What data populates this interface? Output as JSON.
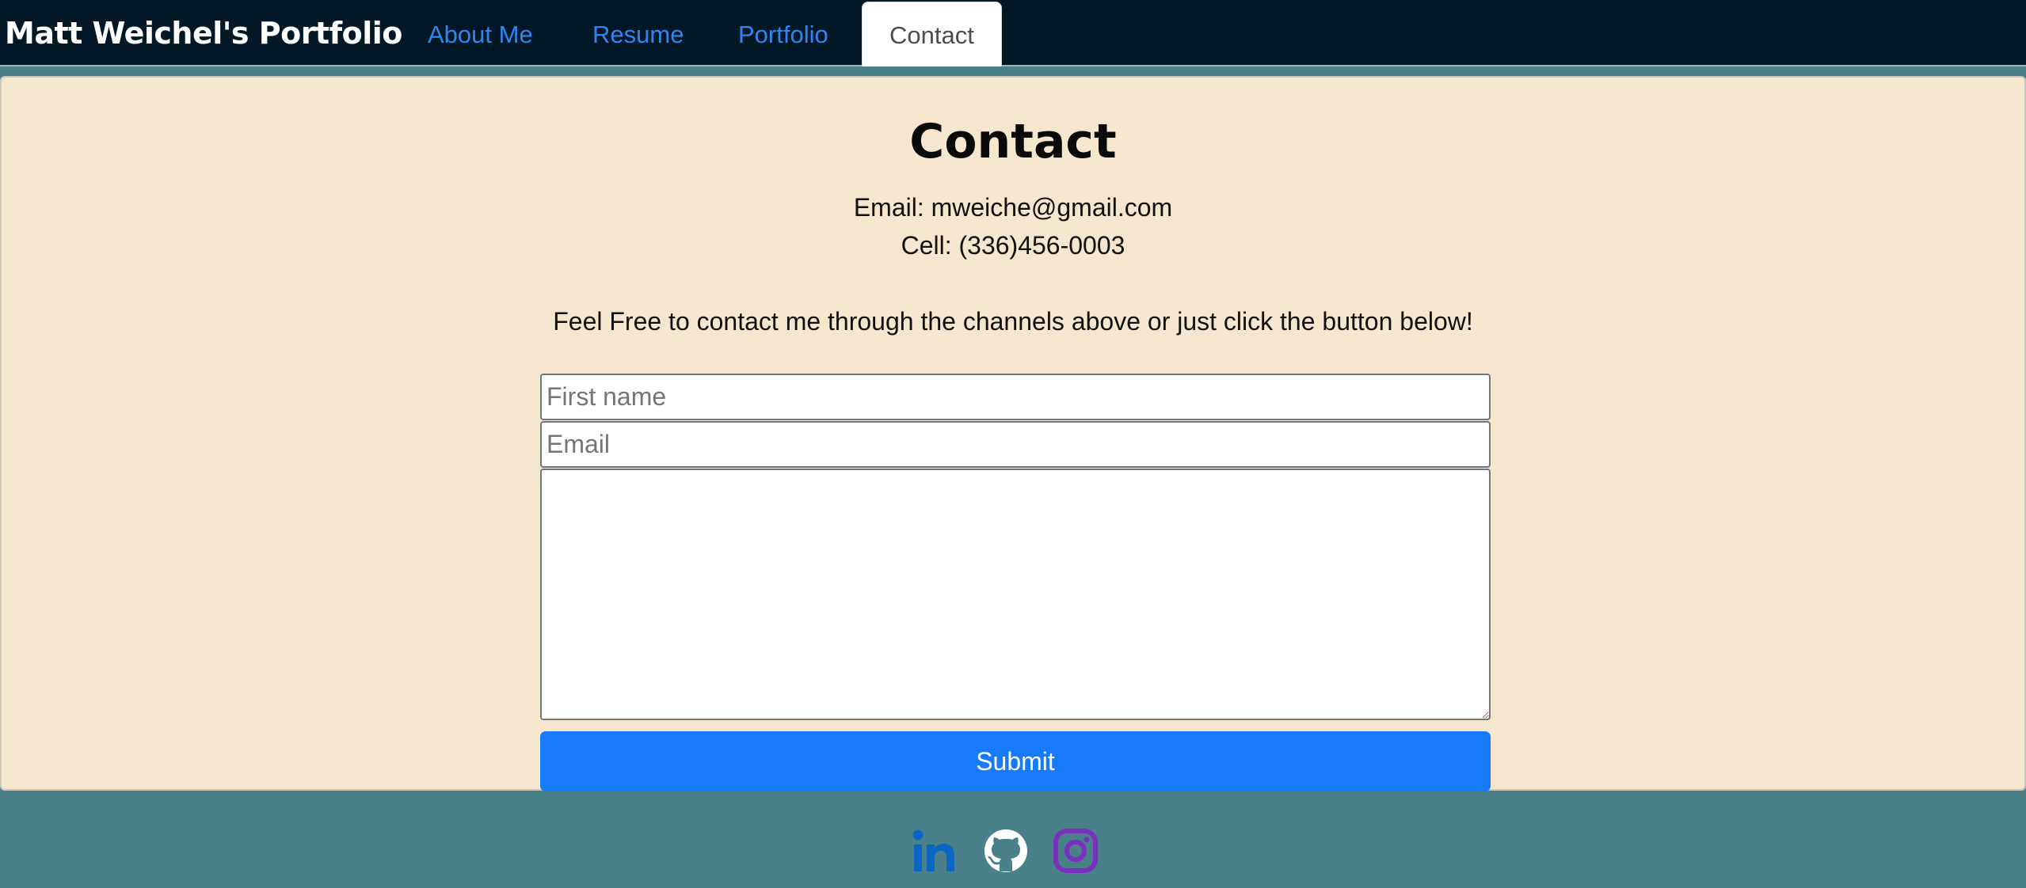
{
  "nav": {
    "brand": "Matt Weichel's Portfolio",
    "links": [
      {
        "label": "About Me"
      },
      {
        "label": "Resume"
      },
      {
        "label": "Portfolio"
      },
      {
        "label": "Contact",
        "active": true
      }
    ]
  },
  "contact": {
    "title": "Contact",
    "email_line": "Email: mweiche@gmail.com",
    "cell_line": "Cell: (336)456-0003",
    "message": "Feel Free to contact me through the channels above or just click the button below!"
  },
  "form": {
    "first_name_placeholder": "First name",
    "email_placeholder": "Email",
    "message_value": "",
    "submit_label": "Submit"
  },
  "footer": {
    "icons": [
      "linkedin-icon",
      "github-icon",
      "instagram-icon"
    ]
  },
  "colors": {
    "navbar_bg": "#021826",
    "page_bg": "#4a8089",
    "card_bg": "#f4e7cd",
    "link": "#2f86f3",
    "submit_bg": "#177af8",
    "linkedin": "#0a66c2",
    "instagram": "#7b2fbf"
  }
}
